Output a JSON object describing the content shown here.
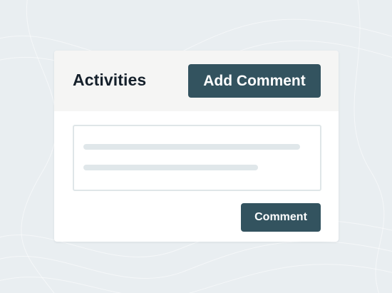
{
  "activities": {
    "title": "Activities",
    "add_comment_label": "Add Comment",
    "comment_label": "Comment"
  },
  "colors": {
    "button": "#33535f",
    "header_bg": "#f5f5f4",
    "page_bg": "#e9eef1"
  }
}
